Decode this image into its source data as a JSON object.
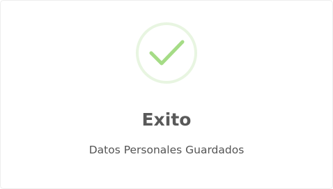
{
  "dialog": {
    "icon": "success-check-icon",
    "title": "Exito",
    "message": "Datos Personales Guardados"
  },
  "colors": {
    "success_ring": "#e8f5e1",
    "success_check": "#a5dc86",
    "title": "#595959",
    "message": "#545454"
  }
}
